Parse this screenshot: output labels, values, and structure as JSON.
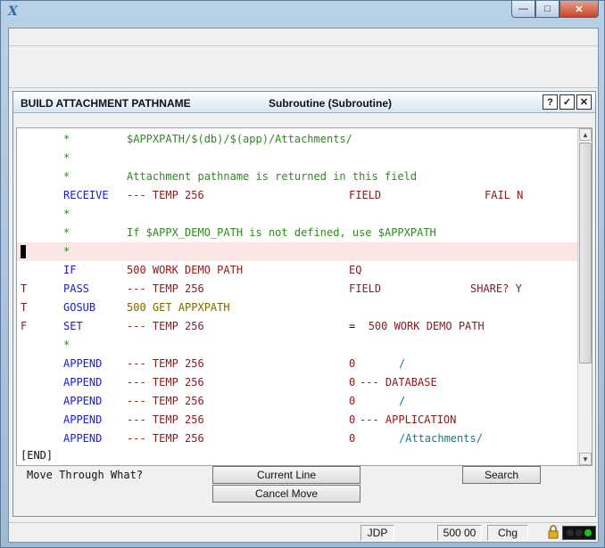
{
  "app": {
    "icon": "app-x-icon",
    "icon_glyph": "X"
  },
  "window_controls": {
    "minimize": "—",
    "maximize": "□",
    "close": "✕"
  },
  "dialog": {
    "title": "BUILD ATTACHMENT PATHNAME",
    "type": "Subroutine  (Subroutine)",
    "help_label": "?",
    "ok_label": "✓",
    "close_label": "✕"
  },
  "code_lines": [
    {
      "flag": "",
      "verb": "*",
      "verb_color": "green",
      "a": "$APPXPATH/$(db)/$(app)/Attachments/",
      "a_color": "green",
      "b": "",
      "c": ""
    },
    {
      "flag": "",
      "verb": "*",
      "verb_color": "green",
      "a": "",
      "b": "",
      "c": ""
    },
    {
      "flag": "",
      "verb": "*",
      "verb_color": "green",
      "a": "Attachment pathname is returned in this field",
      "a_color": "green",
      "b": "",
      "c": ""
    },
    {
      "flag": "",
      "verb": "RECEIVE",
      "verb_color": "blue",
      "a": "--- TEMP 256",
      "a_color": "red",
      "b": "FIELD",
      "b_color": "red",
      "c": "FAIL N",
      "c_color": "red"
    },
    {
      "flag": "",
      "verb": "*",
      "verb_color": "green",
      "a": "",
      "b": "",
      "c": ""
    },
    {
      "flag": "",
      "verb": "*",
      "verb_color": "green",
      "a": "If $APPX_DEMO_PATH is not defined, use $APPXPATH",
      "a_color": "green",
      "b": "",
      "c": ""
    },
    {
      "flag": "",
      "verb": "*",
      "verb_color": "green",
      "a": "",
      "b": "",
      "c": "",
      "highlight": true
    },
    {
      "flag": "",
      "verb": "IF",
      "verb_color": "blue",
      "a": "500 WORK DEMO PATH",
      "a_color": "red",
      "b": "EQ",
      "b_color": "red",
      "c": ""
    },
    {
      "flag": "T",
      "verb": "PASS",
      "verb_color": "blue",
      "a": "--- TEMP 256",
      "a_color": "red",
      "b": "FIELD",
      "b_color": "red",
      "c": "SHARE? Y",
      "c_color": "red"
    },
    {
      "flag": "T",
      "verb": "GOSUB",
      "verb_color": "blue",
      "a": "500 GET APPXPATH",
      "a_color": "olive",
      "b": "",
      "c": ""
    },
    {
      "flag": "F",
      "verb": "SET",
      "verb_color": "blue",
      "a": "--- TEMP 256",
      "a_color": "red",
      "b": "=  500 WORK DEMO PATH",
      "b_color": "mixed",
      "c": ""
    },
    {
      "flag": "",
      "verb": "*",
      "verb_color": "green",
      "a": "",
      "b": "",
      "c": ""
    },
    {
      "flag": "",
      "verb": "APPEND",
      "verb_color": "blue",
      "a": "--- TEMP 256",
      "a_color": "red",
      "b": "0",
      "b_color": "red",
      "c": "/",
      "c_color": "cyan"
    },
    {
      "flag": "",
      "verb": "APPEND",
      "verb_color": "blue",
      "a": "--- TEMP 256",
      "a_color": "red",
      "b": "0",
      "b_color": "red",
      "c": "--- DATABASE",
      "c_color": "red"
    },
    {
      "flag": "",
      "verb": "APPEND",
      "verb_color": "blue",
      "a": "--- TEMP 256",
      "a_color": "red",
      "b": "0",
      "b_color": "red",
      "c": "/",
      "c_color": "cyan"
    },
    {
      "flag": "",
      "verb": "APPEND",
      "verb_color": "blue",
      "a": "--- TEMP 256",
      "a_color": "red",
      "b": "0",
      "b_color": "red",
      "c": "--- APPLICATION",
      "c_color": "red"
    },
    {
      "flag": "",
      "verb": "APPEND",
      "verb_color": "blue",
      "a": "--- TEMP 256",
      "a_color": "red",
      "b": "0",
      "b_color": "red",
      "c": "/Attachments/",
      "c_color": "cyan"
    }
  ],
  "end_marker": "[END]",
  "bottom": {
    "prompt": "Move Through What?",
    "current_line_label": "Current Line",
    "cancel_move_label": "Cancel Move",
    "search_label": "Search"
  },
  "status": {
    "user": "JDP",
    "time": "500 00",
    "mode": "Chg",
    "lock_icon": "lock-icon",
    "lights_colors": [
      "#2a2a2a",
      "#2a2a2a",
      "#1fbf1f"
    ]
  },
  "colors": {
    "blue": "#1a1ad0",
    "green": "#2e8b1e",
    "red": "#8b1a1a",
    "olive": "#7a6a00",
    "cyan": "#107c8c",
    "highlight": "#fbe6e6"
  }
}
